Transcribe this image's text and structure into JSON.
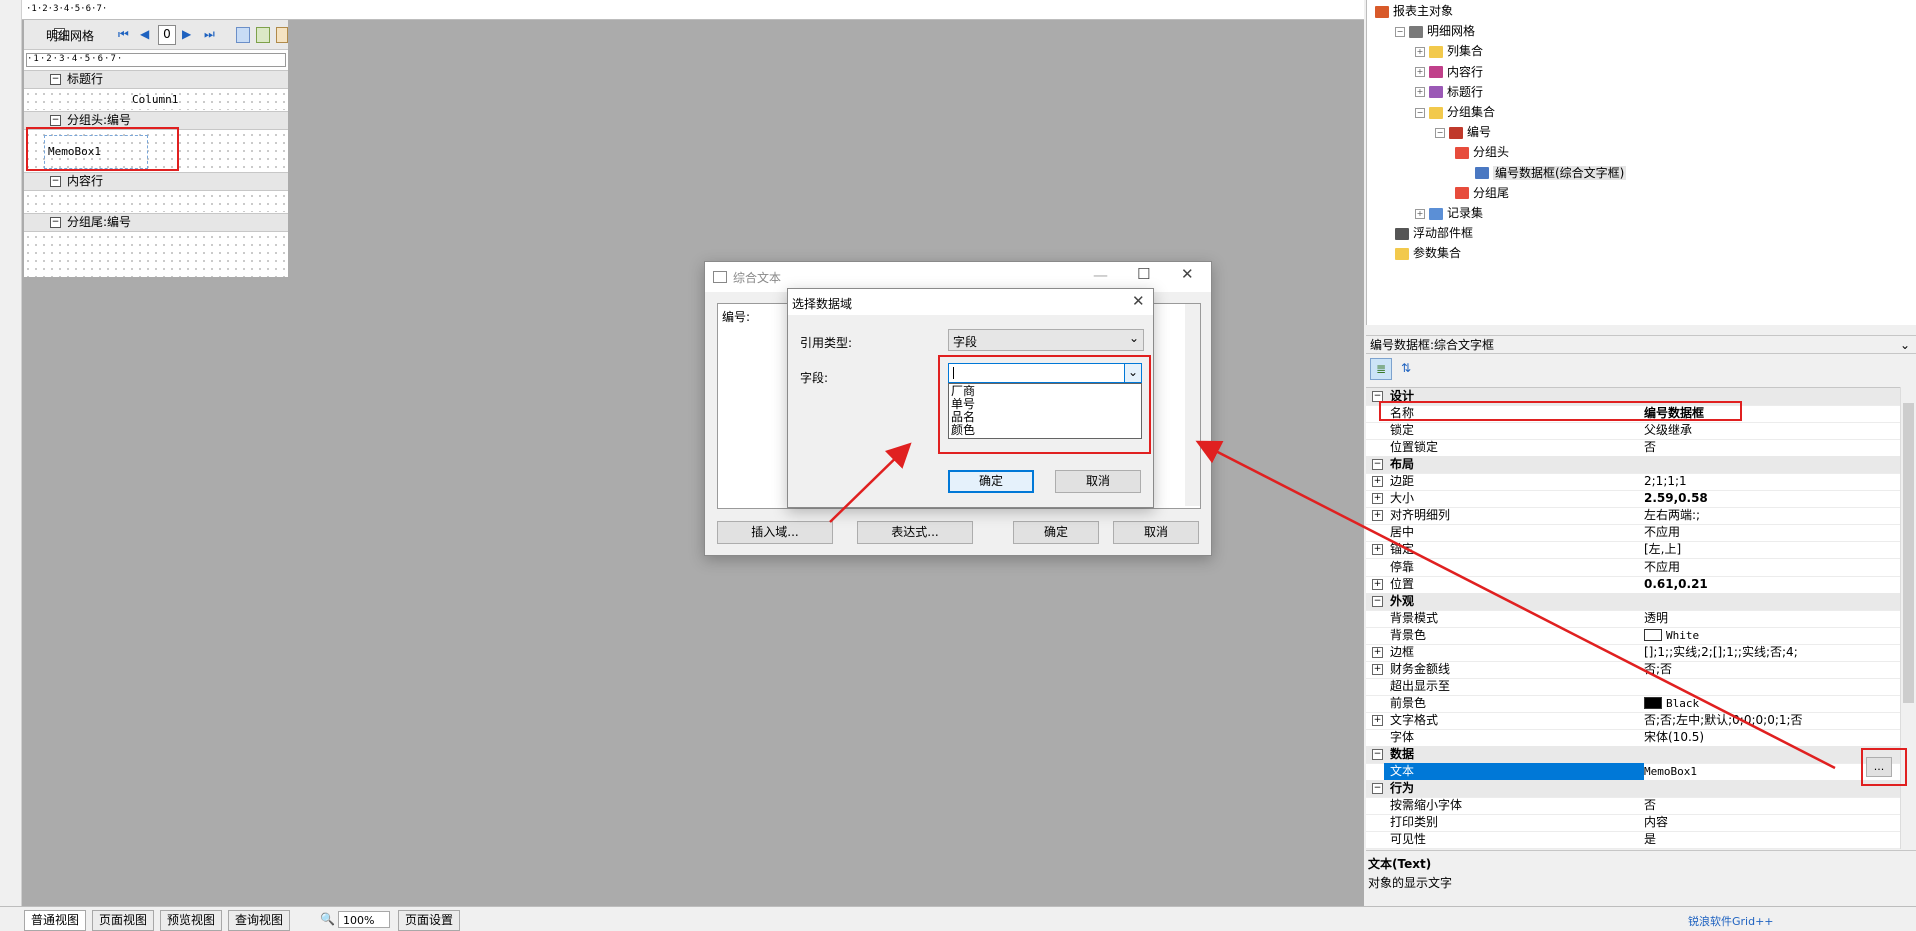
{
  "designer": {
    "toolbar_title": "明细网格",
    "page_number": "0",
    "ruler_text": "·1·2·3·4·5·6·7·",
    "bands": [
      {
        "header": "标题行",
        "content": "Column1"
      },
      {
        "header": "分组头:编号",
        "content": "MemoBox1"
      },
      {
        "header": "内容行",
        "content": ""
      },
      {
        "header": "分组尾:编号",
        "content": ""
      }
    ]
  },
  "tree": [
    {
      "label": "报表主对象",
      "icon": "home-icon",
      "level": 0
    },
    {
      "label": "明细网格",
      "icon": "grid-icon",
      "level": 1
    },
    {
      "label": "列集合",
      "icon": "folder-icon",
      "level": 2
    },
    {
      "label": "内容行",
      "icon": "row-icon",
      "level": 2
    },
    {
      "label": "标题行",
      "icon": "title-row-icon",
      "level": 2
    },
    {
      "label": "分组集合",
      "icon": "folder-icon",
      "level": 2
    },
    {
      "label": "编号",
      "icon": "group-icon",
      "level": 3
    },
    {
      "label": "分组头",
      "icon": "group-header-icon",
      "level": 4
    },
    {
      "label": "编号数据框(综合文字框)",
      "icon": "textbox-icon",
      "level": 5
    },
    {
      "label": "分组尾",
      "icon": "group-footer-icon",
      "level": 4
    },
    {
      "label": "记录集",
      "icon": "recordset-icon",
      "level": 2
    },
    {
      "label": "浮动部件框",
      "icon": "float-box-icon",
      "level": 1
    },
    {
      "label": "参数集合",
      "icon": "folder-icon",
      "level": 1
    }
  ],
  "properties": {
    "header": "编号数据框:综合文字框",
    "rows": [
      {
        "type": "cat",
        "label": "设计"
      },
      {
        "label": "名称",
        "value": "编号数据框",
        "bold": true
      },
      {
        "label": "锁定",
        "value": "父级继承"
      },
      {
        "label": "位置锁定",
        "value": "否"
      },
      {
        "type": "cat",
        "label": "布局"
      },
      {
        "label": "边距",
        "value": "2;1;1;1",
        "exp": true
      },
      {
        "label": "大小",
        "value": "2.59,0.58",
        "exp": true,
        "bold": true
      },
      {
        "label": "对齐明细列",
        "value": "左右两端:;",
        "exp": true
      },
      {
        "label": "居中",
        "value": "不应用"
      },
      {
        "label": "锚定",
        "value": "[左,上]",
        "exp": true
      },
      {
        "label": "停靠",
        "value": "不应用"
      },
      {
        "label": "位置",
        "value": "0.61,0.21",
        "exp": true,
        "bold": true
      },
      {
        "type": "cat",
        "label": "外观"
      },
      {
        "label": "背景模式",
        "value": "透明"
      },
      {
        "label": "背景色",
        "value": "White",
        "swatch": "#ffffff"
      },
      {
        "label": "边框",
        "value": "[];1;;实线;2;[];1;;实线;否;4;",
        "exp": true
      },
      {
        "label": "财务金额线",
        "value": "否;否",
        "exp": true
      },
      {
        "label": "超出显示至",
        "value": ""
      },
      {
        "label": "前景色",
        "value": "Black",
        "swatch": "#000000"
      },
      {
        "label": "文字格式",
        "value": "否;否;左中;默认;0;0;0;0;1;否",
        "exp": true
      },
      {
        "label": "字体",
        "value": "宋体(10.5)"
      },
      {
        "type": "cat",
        "label": "数据"
      },
      {
        "label": "文本",
        "value": "MemoBox1",
        "selected": true
      },
      {
        "type": "cat",
        "label": "行为"
      },
      {
        "label": "按需缩小字体",
        "value": "否"
      },
      {
        "label": "打印类别",
        "value": "内容"
      },
      {
        "label": "可见性",
        "value": "是"
      }
    ],
    "ellipsis_label": "...",
    "desc_title": "文本(Text)",
    "desc_text": "对象的显示文字"
  },
  "statusbar": {
    "tabs": [
      "普通视图",
      "页面视图",
      "预览视图",
      "查询视图"
    ],
    "zoom": "100%",
    "page_setup": "页面设置",
    "right_text": "锐浪软件Grid++"
  },
  "memo_dialog": {
    "title": "综合文本",
    "content": "编号:",
    "buttons": [
      "插入域...",
      "表达式...",
      "确定",
      "取消"
    ]
  },
  "field_dialog": {
    "title": "选择数据域",
    "ref_type_label": "引用类型:",
    "ref_type_value": "字段",
    "field_label": "字段:",
    "field_value": "",
    "options": [
      "厂商",
      "单号",
      "品名",
      "颜色"
    ],
    "ok": "确定",
    "cancel": "取消"
  },
  "colors": {
    "accent": "#0078d7",
    "annotation": "#e02020"
  }
}
